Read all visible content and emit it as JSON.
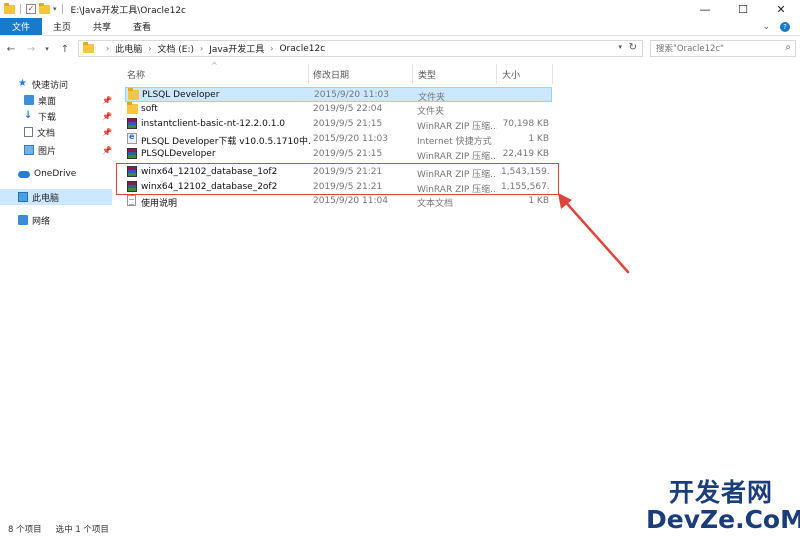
{
  "window": {
    "title": "E:\\Java开发工具\\Oracle12c",
    "controls": {
      "minimize": "—",
      "maximize": "☐",
      "close": "✕"
    }
  },
  "ribbon": {
    "tabs": [
      "文件",
      "主页",
      "共享",
      "查看"
    ],
    "expand_icon": "chevron-down-icon",
    "help_icon": "help-icon"
  },
  "address": {
    "crumbs": [
      "此电脑",
      "文档 (E:)",
      "Java开发工具",
      "Oracle12c"
    ],
    "search_placeholder": "搜索\"Oracle12c\""
  },
  "sidebar": {
    "items": [
      {
        "label": "快速访问",
        "icon": "star-icon",
        "pinned": false,
        "selected": false
      },
      {
        "label": "桌面",
        "icon": "desktop-icon",
        "pinned": true,
        "selected": false
      },
      {
        "label": "下载",
        "icon": "download-icon",
        "pinned": true,
        "selected": false
      },
      {
        "label": "文档",
        "icon": "document-icon",
        "pinned": true,
        "selected": false
      },
      {
        "label": "图片",
        "icon": "pictures-icon",
        "pinned": true,
        "selected": false
      },
      {
        "label": "OneDrive",
        "icon": "onedrive-icon",
        "pinned": false,
        "selected": false
      },
      {
        "label": "此电脑",
        "icon": "this-pc-icon",
        "pinned": false,
        "selected": true
      },
      {
        "label": "网络",
        "icon": "network-icon",
        "pinned": false,
        "selected": false
      }
    ]
  },
  "columns": {
    "name": "名称",
    "date": "修改日期",
    "type": "类型",
    "size": "大小"
  },
  "files": [
    {
      "name": "PLSQL Developer",
      "date": "2015/9/20 11:03",
      "type": "文件夹",
      "size": "",
      "icon": "folder-icon",
      "selected": true
    },
    {
      "name": "soft",
      "date": "2019/9/5 22:04",
      "type": "文件夹",
      "size": "",
      "icon": "folder-icon",
      "selected": false
    },
    {
      "name": "instantclient-basic-nt-12.2.0.1.0",
      "date": "2019/9/5 21:15",
      "type": "WinRAR ZIP 压缩...",
      "size": "70,198 KB",
      "icon": "winrar-zip-icon",
      "selected": false
    },
    {
      "name": "PLSQL Developer下载 v10.0.5.1710中...",
      "date": "2015/9/20 11:03",
      "type": "Internet 快捷方式",
      "size": "1 KB",
      "icon": "internet-shortcut-icon",
      "selected": false
    },
    {
      "name": "PLSQLDeveloper",
      "date": "2019/9/5 21:15",
      "type": "WinRAR ZIP 压缩...",
      "size": "22,419 KB",
      "icon": "winrar-zip-icon",
      "selected": false
    },
    {
      "name": "winx64_12102_database_1of2",
      "date": "2019/9/5 21:21",
      "type": "WinRAR ZIP 压缩...",
      "size": "1,543,159...",
      "icon": "winrar-zip-icon",
      "selected": false
    },
    {
      "name": "winx64_12102_database_2of2",
      "date": "2019/9/5 21:21",
      "type": "WinRAR ZIP 压缩...",
      "size": "1,155,567...",
      "icon": "winrar-zip-icon",
      "selected": false
    },
    {
      "name": "使用说明",
      "date": "2015/9/20 11:04",
      "type": "文本文档",
      "size": "1 KB",
      "icon": "text-document-icon",
      "selected": false
    }
  ],
  "status": {
    "count": "8 个项目",
    "selection": "选中 1 个项目"
  },
  "watermark": {
    "line1": "开发者网",
    "line2": "DevZe.CoM"
  },
  "colors": {
    "accent": "#1979ca",
    "selection": "#cce8ff",
    "annotation": "#e0453c"
  }
}
